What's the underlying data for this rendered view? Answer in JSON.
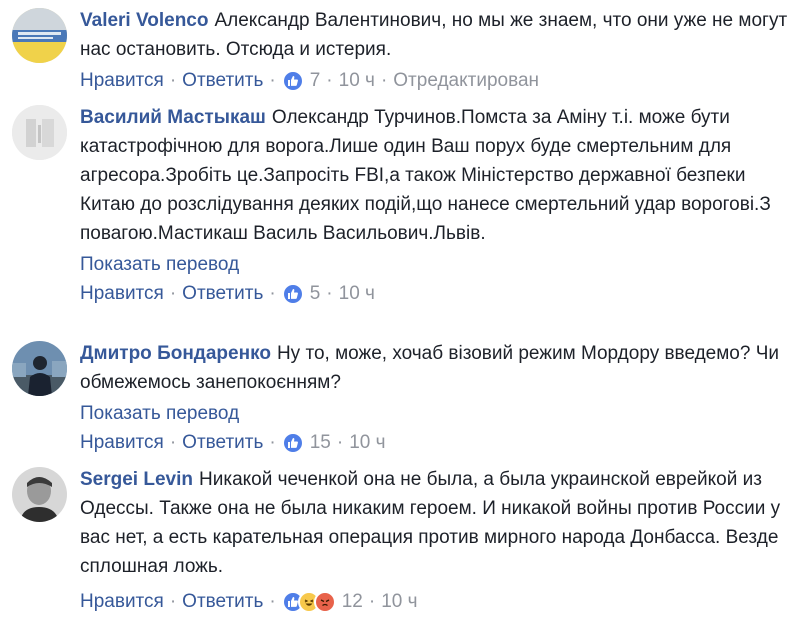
{
  "ui": {
    "like_label": "Нравится",
    "reply_label": "Ответить",
    "separator": "·",
    "translate_label": "Показать перевод"
  },
  "comments": [
    {
      "author": "Valeri Volenco",
      "text": "Александр Валентинович, но мы же знаем, что они уже не могут нас остановить. Отсюда и истерия.",
      "reactions": [
        "like"
      ],
      "count": "7",
      "time": "10 ч",
      "edited": "Отредактирован"
    },
    {
      "author": "Василий Мастыкаш",
      "text": "Олександр Турчинов.Помста за Аміну т.і. може бути катастрофічною для ворога.Лише один Ваш порух буде смертельним для агресора.Зробіть це.Запросіть FBI,а також Міністерство державної безпеки Китаю до розслідування деяких подій,що нанесе смертельний удар ворогові.З повагою.Мастикаш Василь Васильович.Львів.",
      "reactions": [
        "like"
      ],
      "count": "5",
      "time": "10 ч"
    },
    {
      "author": "Дмитро Бондаренко",
      "text": "Ну то, може, хочаб візовий режим Мордору введемо? Чи обмежемось занепокоєнням?",
      "reactions": [
        "like"
      ],
      "count": "15",
      "time": "10 ч"
    },
    {
      "author": "Sergei Levin",
      "text": "Никакой чеченкой она не была, а была украинской еврейкой из Одессы. Также она не была никаким героем. И никакой войны против России у вас нет, а есть карательная операция против мирного народа Донбасса. Везде сплошная ложь.",
      "reactions": [
        "like",
        "haha",
        "angry"
      ],
      "count": "12",
      "time": "10 ч"
    }
  ],
  "colors": {
    "link": "#365899",
    "meta": "#90949c",
    "text": "#1d2129",
    "like": "#4f7ee8",
    "haha": "#f7c84b",
    "angry": "#e8624a"
  }
}
